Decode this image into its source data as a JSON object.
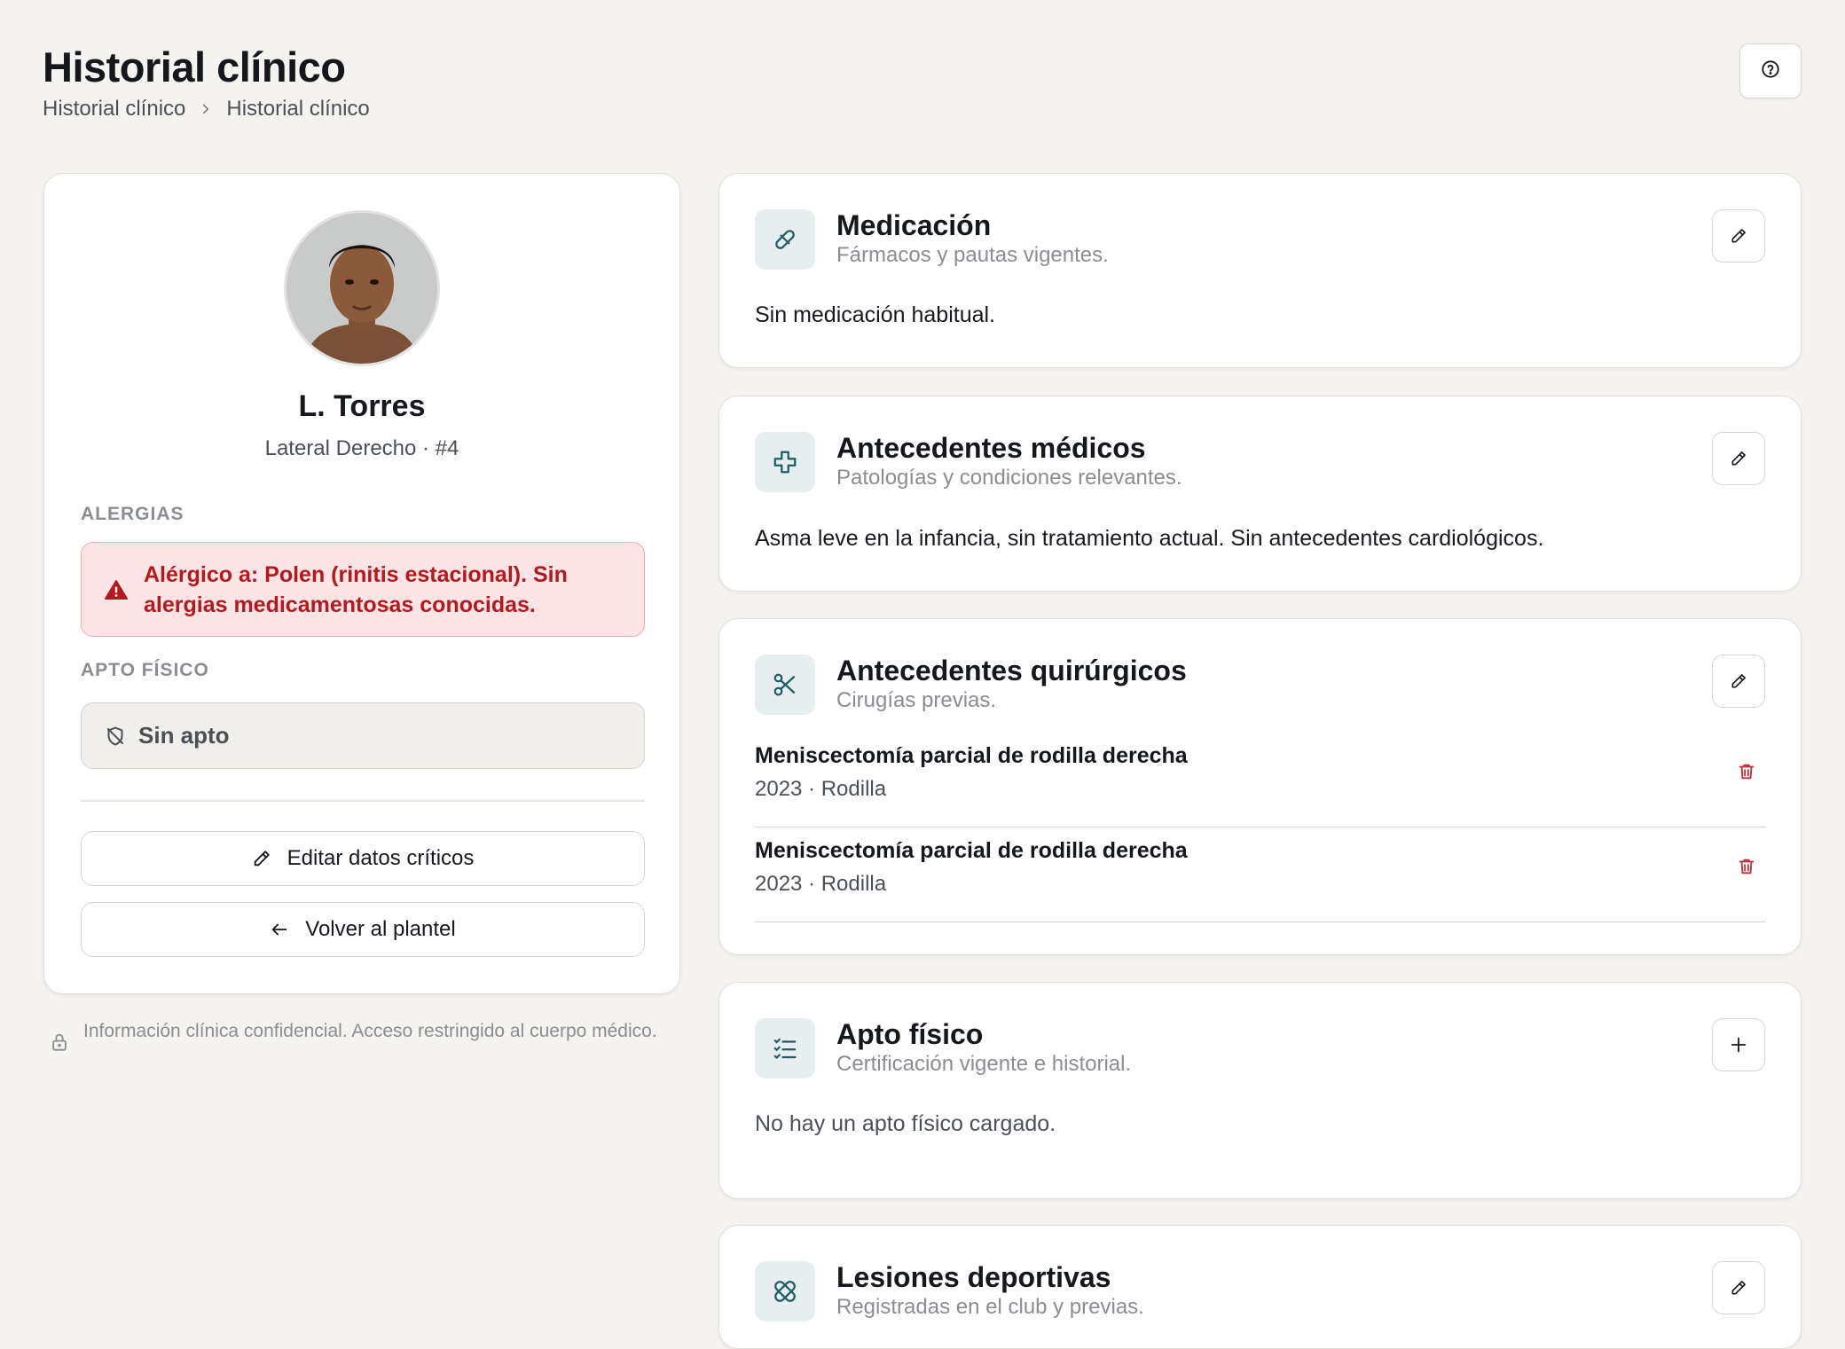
{
  "header": {
    "title": "Historial clínico",
    "breadcrumb": [
      "Historial clínico",
      "Historial clínico"
    ],
    "help_icon": "help-circle-icon"
  },
  "profile": {
    "name": "L. Torres",
    "meta": "Lateral Derecho · #4",
    "allergies_label": "ALERGIAS",
    "allergies_text": "Alérgico a: Polen (rinitis estacional). Sin alergias medicamentosas conocidas.",
    "fitness_label": "APTO FÍSICO",
    "fitness_status": "Sin apto",
    "edit_button": "Editar datos críticos",
    "back_button": "Volver al plantel",
    "confidential_note": "Información clínica confidencial. Acceso restringido al cuerpo médico."
  },
  "sections": {
    "medication": {
      "title": "Medicación",
      "subtitle": "Fármacos y pautas vigentes.",
      "body": "Sin medicación habitual.",
      "icon": "pill-icon"
    },
    "medical_history": {
      "title": "Antecedentes médicos",
      "subtitle": "Patologías y condiciones relevantes.",
      "body": "Asma leve en la infancia, sin tratamiento actual. Sin antecedentes cardiológicos.",
      "icon": "medical-cross-icon"
    },
    "surgical_history": {
      "title": "Antecedentes quirúrgicos",
      "subtitle": "Cirugías previas.",
      "icon": "scissors-icon",
      "items": [
        {
          "name": "Meniscectomía parcial de rodilla derecha",
          "meta": "2023 · Rodilla"
        },
        {
          "name": "Meniscectomía parcial de rodilla derecha",
          "meta": "2023 · Rodilla"
        }
      ]
    },
    "fitness": {
      "title": "Apto físico",
      "subtitle": "Certificación vigente e historial.",
      "body": "No hay un apto físico cargado.",
      "icon": "checklist-icon"
    },
    "injuries": {
      "title": "Lesiones deportivas",
      "subtitle": "Registradas en el club y previas.",
      "icon": "bandage-icon"
    }
  },
  "colors": {
    "background": "#f5f3ef",
    "accent": "#1f5c66",
    "danger": "#b3191f",
    "danger_bg": "#fde4e5"
  }
}
